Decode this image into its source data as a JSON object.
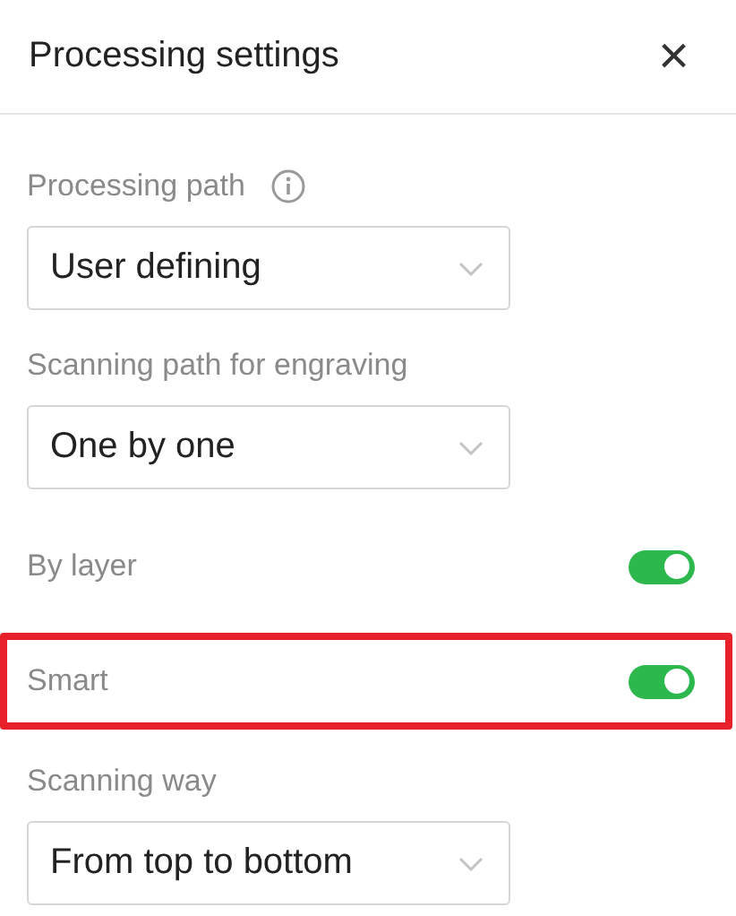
{
  "header": {
    "title": "Processing settings",
    "close": "×"
  },
  "items": [
    {
      "kind": "select",
      "label": "Processing path",
      "info": true,
      "value": "User defining"
    },
    {
      "kind": "select",
      "label": "Scanning path for engraving",
      "info": false,
      "value": "One by one"
    },
    {
      "kind": "toggle",
      "label": "By layer",
      "on": true,
      "highlighted": false
    },
    {
      "kind": "toggle",
      "label": "Smart",
      "on": true,
      "highlighted": true
    },
    {
      "kind": "select",
      "label": "Scanning way",
      "info": false,
      "value": "From top to bottom"
    }
  ]
}
